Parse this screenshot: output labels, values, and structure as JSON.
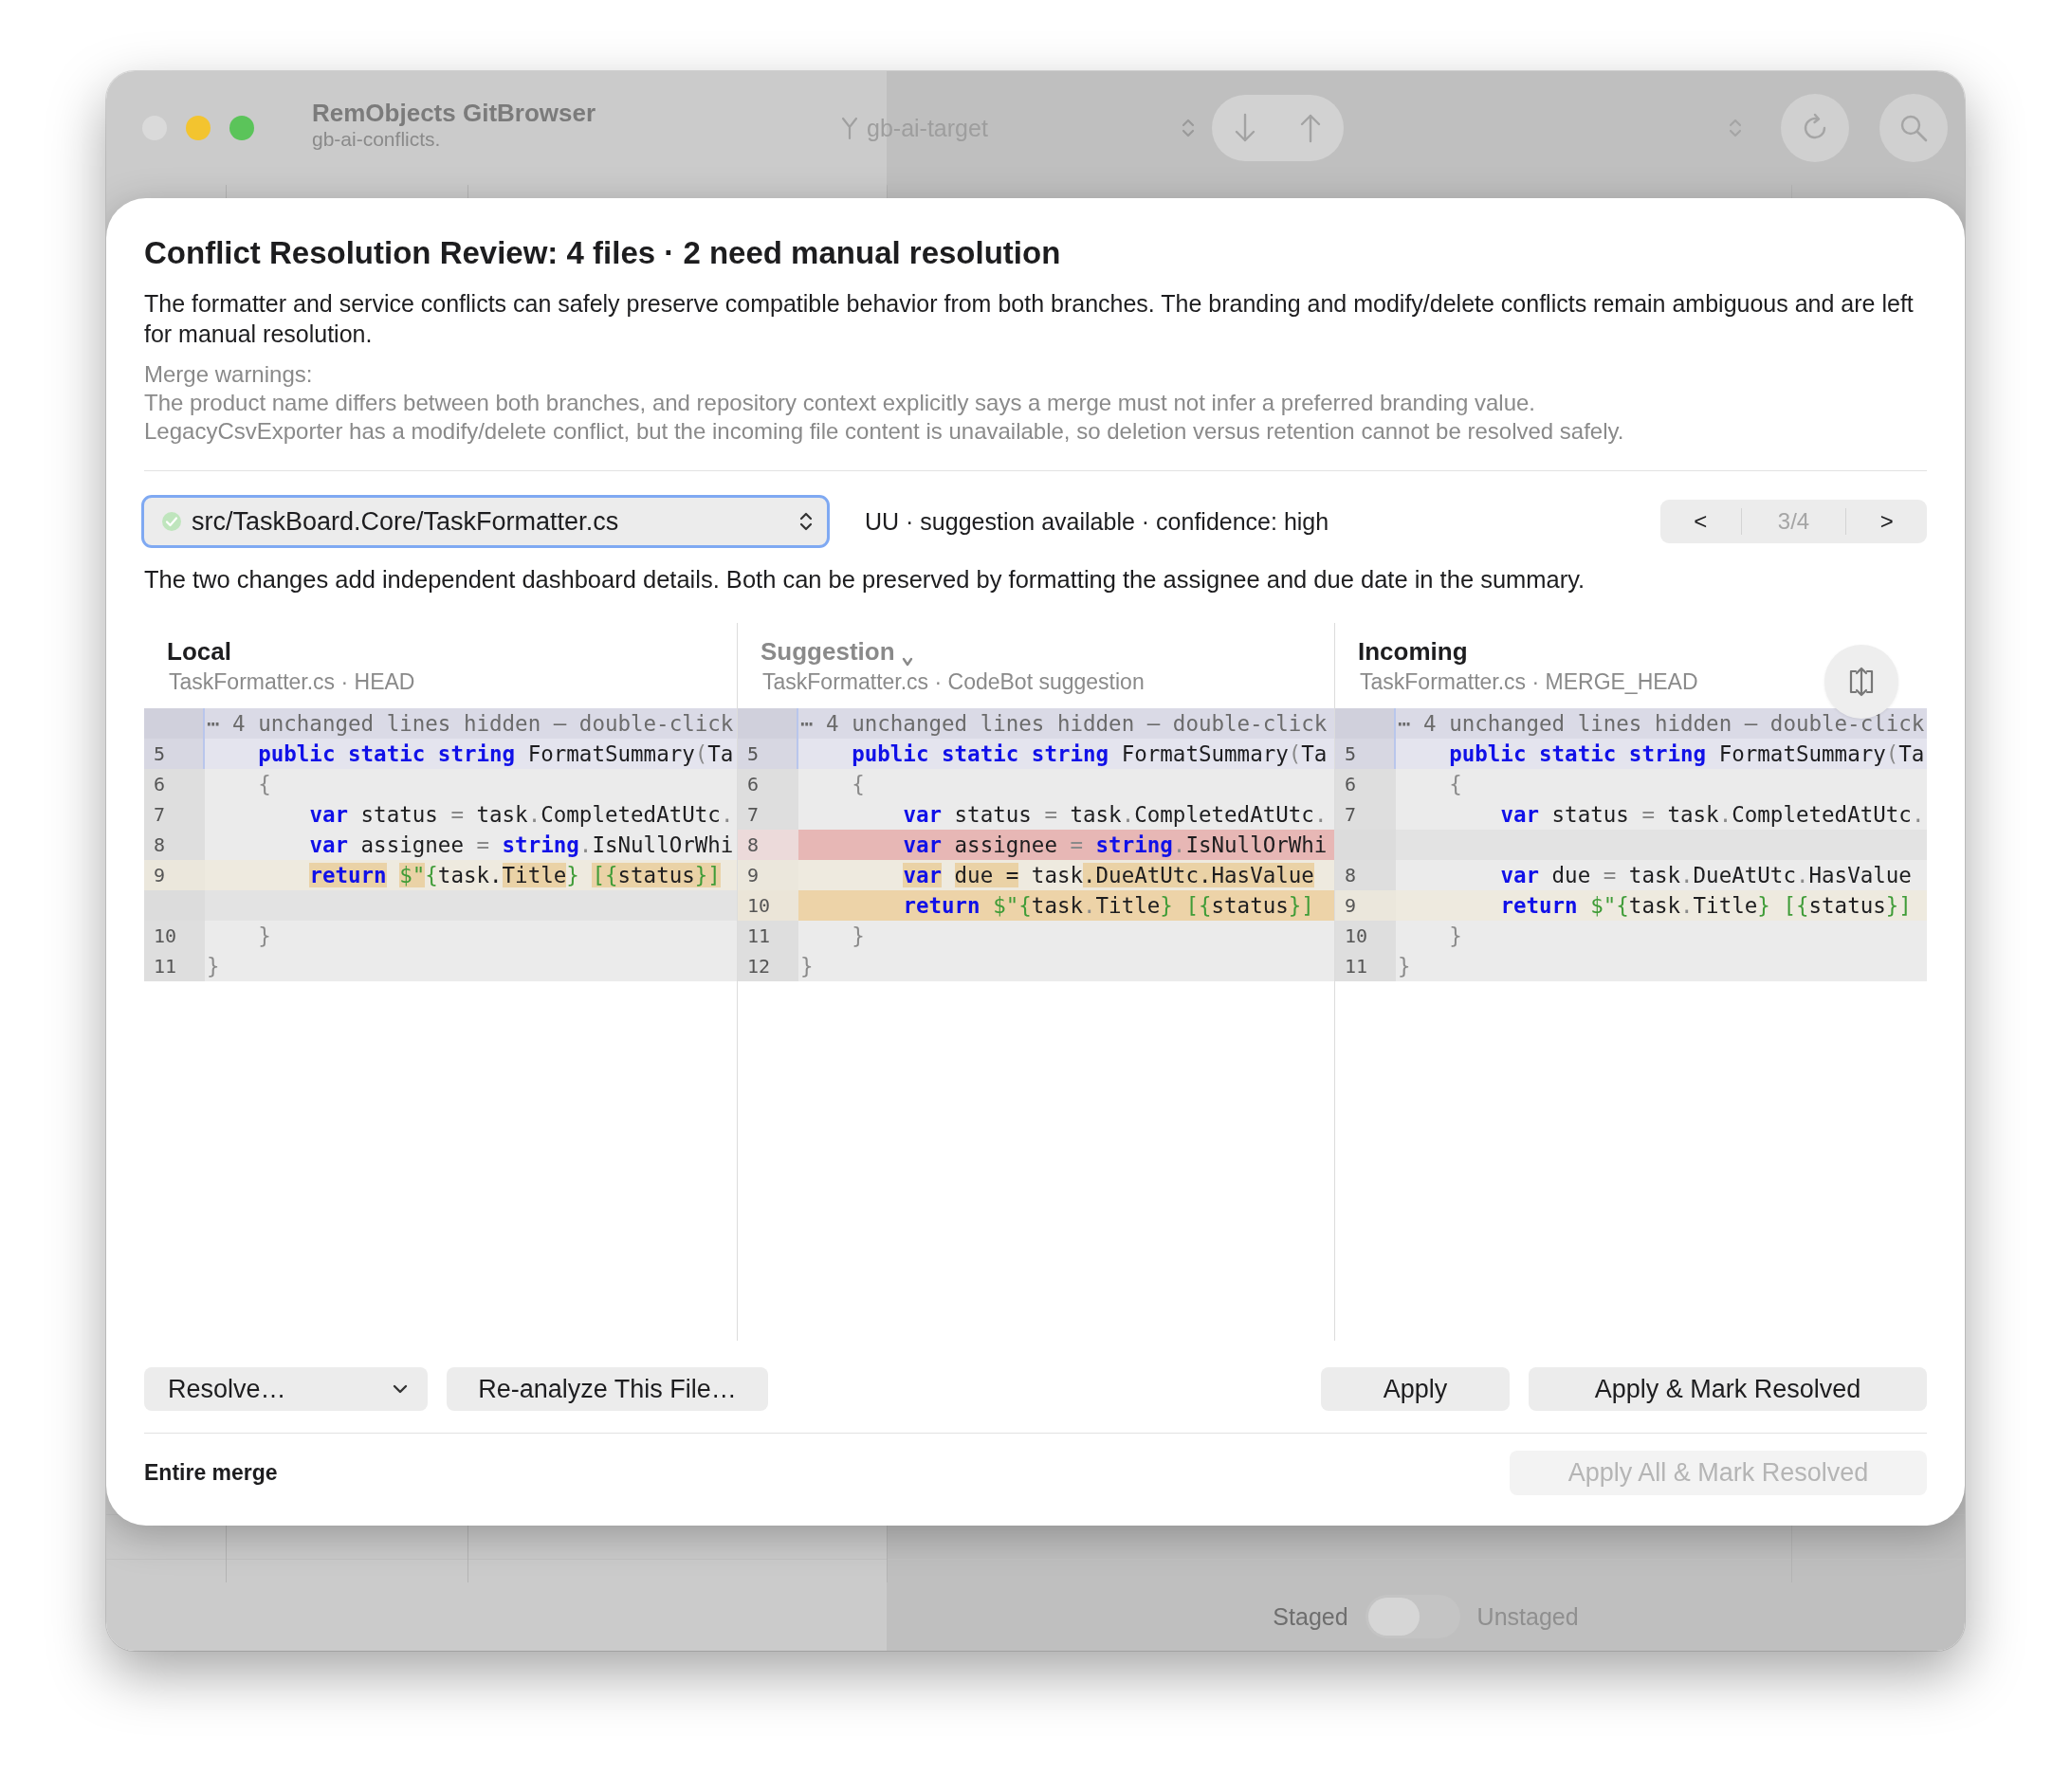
{
  "window": {
    "title": "RemObjects GitBrowser",
    "subtitle": "gb-ai-conflicts.",
    "branch": "gb-ai-target"
  },
  "stage_toggle": {
    "left_label": "Staged",
    "right_label": "Unstaged",
    "on": false
  },
  "review": {
    "title": "Conflict Resolution Review: 4 files · 2 need manual resolution",
    "summary": "The formatter and service conflicts can safely preserve compatible behavior from both branches. The branding and modify/delete conflicts remain ambiguous and are left for manual resolution.",
    "warnings_label": "Merge warnings:",
    "warnings": [
      "The product name differs between both branches, and repository context explicitly says a merge must not infer a preferred branding value.",
      "LegacyCsvExporter has a modify/delete conflict, but the incoming file content is unavailable, so deletion versus retention cannot be resolved safely."
    ],
    "file_picker": {
      "value": "src/TaskBoard.Core/TaskFormatter.cs",
      "resolved": true
    },
    "file_status": "UU · suggestion available · confidence: high",
    "navigator": {
      "previous": "<",
      "position": "3/4",
      "next": ">"
    },
    "explanation": "The two changes add independent dashboard details. Both can be preserved by formatting the assignee and due date in the summary.",
    "panels": [
      {
        "title": "Local",
        "kind": "plain",
        "subtitle": "TaskFormatter.cs · HEAD",
        "rows": [
          {
            "kind": "banner",
            "text": "⋯ 4 unchanged lines hidden — double-click"
          },
          {
            "kind": "hunk",
            "number": "5",
            "tokens": [
              {
                "text": "    public static string",
                "kind": "kw"
              },
              {
                "text": " FormatSummary"
              },
              {
                "text": "(",
                "kind": "op"
              },
              {
                "text": "Ta"
              }
            ]
          },
          {
            "kind": "context",
            "number": "6",
            "tokens": [
              {
                "text": "    {",
                "kind": "op"
              }
            ]
          },
          {
            "kind": "context",
            "number": "7",
            "tokens": [
              {
                "text": "        var",
                "kind": "kw"
              },
              {
                "text": " status "
              },
              {
                "text": "=",
                "kind": "op"
              },
              {
                "text": " task"
              },
              {
                "text": ".",
                "kind": "op"
              },
              {
                "text": "CompletedAtUtc"
              },
              {
                "text": ".",
                "kind": "op"
              }
            ]
          },
          {
            "kind": "context",
            "number": "8",
            "tokens": [
              {
                "text": "        var",
                "kind": "kw"
              },
              {
                "text": " assignee "
              },
              {
                "text": "=",
                "kind": "op"
              },
              {
                "text": " string",
                "kind": "kw"
              },
              {
                "text": ".",
                "kind": "op"
              },
              {
                "text": "IsNullOrWhi"
              }
            ]
          },
          {
            "kind": "modified",
            "number": "9",
            "tokens": [
              {
                "text": "        return",
                "kind": "kw",
                "marked": true
              },
              {
                "text": " $\"",
                "kind": "str",
                "marked": true
              },
              {
                "text": "{",
                "kind": "str",
                "marked": false
              },
              {
                "text": "task.",
                "marked": false
              },
              {
                "text": "Title",
                "marked": true
              },
              {
                "text": "}",
                "kind": "str",
                "marked": false
              },
              {
                "text": " [{",
                "kind": "str",
                "marked": true
              },
              {
                "text": "status",
                "marked": true
              },
              {
                "text": "}]",
                "kind": "str",
                "marked": true
              }
            ]
          },
          {
            "kind": "blank"
          },
          {
            "kind": "context",
            "number": "10",
            "tokens": [
              {
                "text": "    }",
                "kind": "op"
              }
            ]
          },
          {
            "kind": "context",
            "number": "11",
            "tokens": [
              {
                "text": "}",
                "kind": "op"
              }
            ]
          }
        ]
      },
      {
        "title": "Suggestion",
        "kind": "menu",
        "subtitle": "TaskFormatter.cs · CodeBot suggestion",
        "rows": [
          {
            "kind": "banner",
            "text": "⋯ 4 unchanged lines hidden — double-click"
          },
          {
            "kind": "hunk",
            "number": "5",
            "tokens": [
              {
                "text": "    public static string",
                "kind": "kw"
              },
              {
                "text": " FormatSummary"
              },
              {
                "text": "(",
                "kind": "op"
              },
              {
                "text": "Ta"
              }
            ]
          },
          {
            "kind": "context",
            "number": "6",
            "tokens": [
              {
                "text": "    {",
                "kind": "op"
              }
            ]
          },
          {
            "kind": "context",
            "number": "7",
            "tokens": [
              {
                "text": "        var",
                "kind": "kw"
              },
              {
                "text": " status "
              },
              {
                "text": "=",
                "kind": "op"
              },
              {
                "text": " task"
              },
              {
                "text": ".",
                "kind": "op"
              },
              {
                "text": "CompletedAtUtc"
              },
              {
                "text": ".",
                "kind": "op"
              }
            ]
          },
          {
            "kind": "removed",
            "number": "8",
            "tokens": [
              {
                "text": "        var",
                "kind": "kw"
              },
              {
                "text": " assignee "
              },
              {
                "text": "=",
                "kind": "op"
              },
              {
                "text": " string",
                "kind": "kw"
              },
              {
                "text": ".",
                "kind": "op"
              },
              {
                "text": "IsNullOrWhi"
              }
            ]
          },
          {
            "kind": "modified",
            "number": "9",
            "tokens": [
              {
                "text": "        var",
                "kind": "kw",
                "marked": true
              },
              {
                "text": " due =",
                "marked": true
              },
              {
                "text": " task",
                "marked": false
              },
              {
                "text": ".DueAtUtc.HasValue",
                "marked": true
              }
            ]
          },
          {
            "kind": "added",
            "number": "10",
            "tokens": [
              {
                "text": "        return",
                "kind": "kw"
              },
              {
                "text": " $\"{",
                "kind": "str"
              },
              {
                "text": "task"
              },
              {
                "text": ".",
                "kind": "op"
              },
              {
                "text": "Title"
              },
              {
                "text": "}",
                "kind": "str"
              },
              {
                "text": " [{",
                "kind": "str"
              },
              {
                "text": "status"
              },
              {
                "text": "}]",
                "kind": "str"
              }
            ]
          },
          {
            "kind": "context",
            "number": "11",
            "tokens": [
              {
                "text": "    }",
                "kind": "op"
              }
            ]
          },
          {
            "kind": "context",
            "number": "12",
            "tokens": [
              {
                "text": "}",
                "kind": "op"
              }
            ]
          }
        ]
      },
      {
        "title": "Incoming",
        "kind": "plain",
        "subtitle": "TaskFormatter.cs · MERGE_HEAD",
        "expand_button": true,
        "rows": [
          {
            "kind": "banner",
            "text": "⋯ 4 unchanged lines hidden — double-click"
          },
          {
            "kind": "hunk",
            "number": "5",
            "tokens": [
              {
                "text": "    public static string",
                "kind": "kw"
              },
              {
                "text": " FormatSummary"
              },
              {
                "text": "(",
                "kind": "op"
              },
              {
                "text": "Ta"
              }
            ]
          },
          {
            "kind": "context",
            "number": "6",
            "tokens": [
              {
                "text": "    {",
                "kind": "op"
              }
            ]
          },
          {
            "kind": "context",
            "number": "7",
            "tokens": [
              {
                "text": "        var",
                "kind": "kw"
              },
              {
                "text": " status "
              },
              {
                "text": "=",
                "kind": "op"
              },
              {
                "text": " task"
              },
              {
                "text": ".",
                "kind": "op"
              },
              {
                "text": "CompletedAtUtc"
              },
              {
                "text": ".",
                "kind": "op"
              }
            ]
          },
          {
            "kind": "blank"
          },
          {
            "kind": "context",
            "number": "8",
            "tokens": [
              {
                "text": "        var",
                "kind": "kw"
              },
              {
                "text": " due "
              },
              {
                "text": "=",
                "kind": "op"
              },
              {
                "text": " task"
              },
              {
                "text": ".",
                "kind": "op"
              },
              {
                "text": "DueAtUtc"
              },
              {
                "text": ".",
                "kind": "op"
              },
              {
                "text": "HasValue"
              }
            ]
          },
          {
            "kind": "modified",
            "number": "9",
            "tokens": [
              {
                "text": "        return",
                "kind": "kw"
              },
              {
                "text": " $\"{",
                "kind": "str"
              },
              {
                "text": "task"
              },
              {
                "text": ".",
                "kind": "op"
              },
              {
                "text": "Title"
              },
              {
                "text": "}",
                "kind": "str"
              },
              {
                "text": " [{",
                "kind": "str"
              },
              {
                "text": "status"
              },
              {
                "text": "}]",
                "kind": "str"
              }
            ]
          },
          {
            "kind": "context",
            "number": "10",
            "tokens": [
              {
                "text": "    }",
                "kind": "op"
              }
            ]
          },
          {
            "kind": "context",
            "number": "11",
            "tokens": [
              {
                "text": "}",
                "kind": "op"
              }
            ]
          }
        ]
      }
    ],
    "left_actions": [
      {
        "label": "Resolve…",
        "kind": "menu",
        "disabled": false
      },
      {
        "label": "Re-analyze This File…",
        "kind": "push",
        "disabled": false
      }
    ],
    "right_actions": [
      {
        "label": "Apply",
        "disabled": false
      },
      {
        "label": "Apply & Mark Resolved",
        "disabled": false
      }
    ],
    "footer": {
      "label": "Entire merge",
      "action": {
        "label": "Apply All & Mark Resolved",
        "disabled": true
      }
    }
  }
}
